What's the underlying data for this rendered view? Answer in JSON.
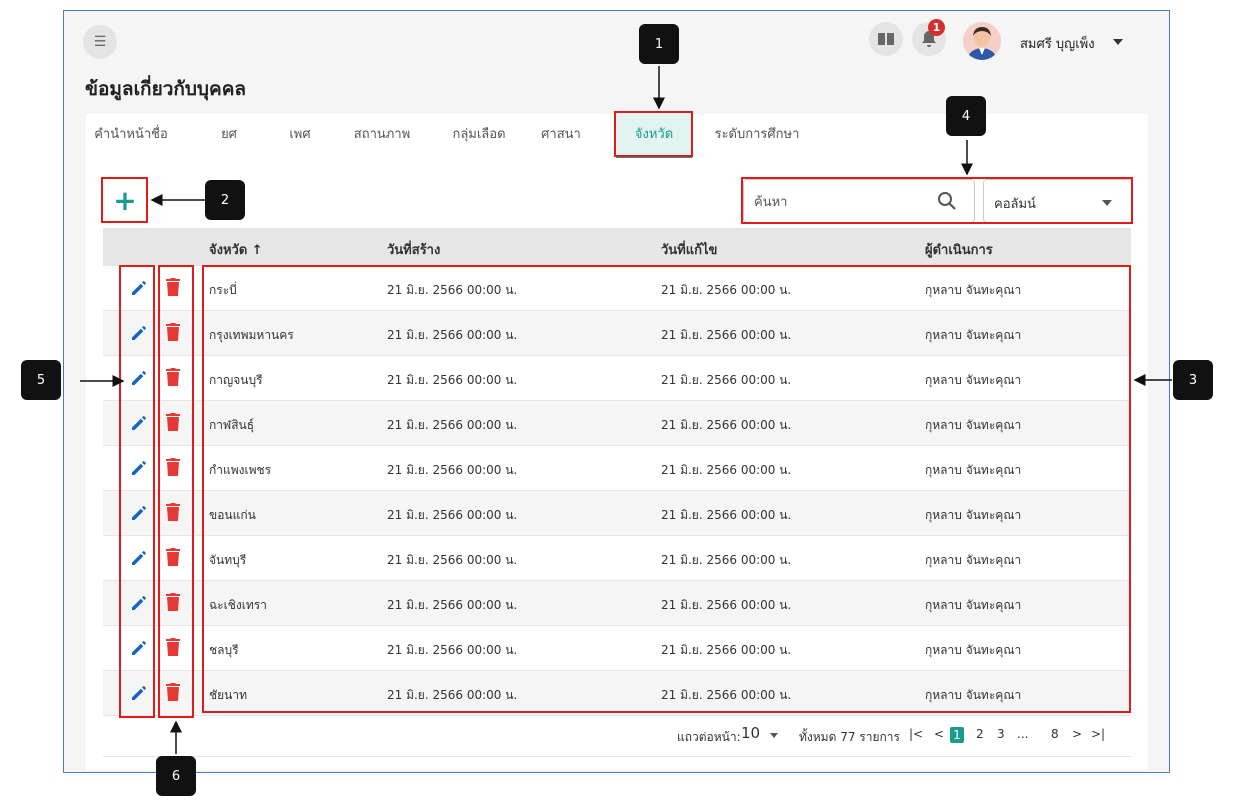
{
  "header": {
    "title": "ข้อมูลเกี่ยวกับบุคคล",
    "notification_count": "1",
    "user_name": "สมศรี บุญเพ็ง"
  },
  "tabs": [
    {
      "label": "คำนำหน้าชื่อ"
    },
    {
      "label": "ยศ"
    },
    {
      "label": "เพศ"
    },
    {
      "label": "สถานภาพ"
    },
    {
      "label": "กลุ่มเลือด"
    },
    {
      "label": "ศาสนา"
    },
    {
      "label": "จังหวัด"
    },
    {
      "label": "ระดับการศึกษา"
    }
  ],
  "toolbar": {
    "add_label": "+",
    "search_placeholder": "ค้นหา",
    "column_select_value": "คอลัมน์"
  },
  "table": {
    "columns": [
      "จังหวัด ↑",
      "วันที่สร้าง",
      "วันที่แก้ไข",
      "ผู้ดำเนินการ"
    ],
    "rows": [
      {
        "province": "กระบี่",
        "created": "21 มิ.ย. 2566 00:00 น.",
        "modified": "21 มิ.ย. 2566 00:00 น.",
        "operator": "กุหลาบ จันทะคุณา"
      },
      {
        "province": "กรุงเทพมหานคร",
        "created": "21 มิ.ย. 2566 00:00 น.",
        "modified": "21 มิ.ย. 2566 00:00 น.",
        "operator": "กุหลาบ จันทะคุณา"
      },
      {
        "province": "กาญจนบุรี",
        "created": "21 มิ.ย. 2566 00:00 น.",
        "modified": "21 มิ.ย. 2566 00:00 น.",
        "operator": "กุหลาบ จันทะคุณา"
      },
      {
        "province": "กาฬสินธุ์",
        "created": "21 มิ.ย. 2566 00:00 น.",
        "modified": "21 มิ.ย. 2566 00:00 น.",
        "operator": "กุหลาบ จันทะคุณา"
      },
      {
        "province": "กำแพงเพชร",
        "created": "21 มิ.ย. 2566 00:00 น.",
        "modified": "21 มิ.ย. 2566 00:00 น.",
        "operator": "กุหลาบ จันทะคุณา"
      },
      {
        "province": "ขอนแก่น",
        "created": "21 มิ.ย. 2566 00:00 น.",
        "modified": "21 มิ.ย. 2566 00:00 น.",
        "operator": "กุหลาบ จันทะคุณา"
      },
      {
        "province": "จันทบุรี",
        "created": "21 มิ.ย. 2566 00:00 น.",
        "modified": "21 มิ.ย. 2566 00:00 น.",
        "operator": "กุหลาบ จันทะคุณา"
      },
      {
        "province": "ฉะเชิงเทรา",
        "created": "21 มิ.ย. 2566 00:00 น.",
        "modified": "21 มิ.ย. 2566 00:00 น.",
        "operator": "กุหลาบ จันทะคุณา"
      },
      {
        "province": "ชลบุรี",
        "created": "21 มิ.ย. 2566 00:00 น.",
        "modified": "21 มิ.ย. 2566 00:00 น.",
        "operator": "กุหลาบ จันทะคุณา"
      },
      {
        "province": "ชัยนาท",
        "created": "21 มิ.ย. 2566 00:00 น.",
        "modified": "21 มิ.ย. 2566 00:00 น.",
        "operator": "กุหลาบ จันทะคุณา"
      }
    ]
  },
  "pagination": {
    "rows_per_page_label": "แถวต่อหน้า:",
    "rows_per_page": "10",
    "total_label": "ทั้งหมด 77 รายการ",
    "first": "|<",
    "prev": "<",
    "pages": [
      "1",
      "2",
      "3",
      "...",
      "8"
    ],
    "next": ">",
    "last": ">|"
  },
  "callouts": [
    "1",
    "2",
    "3",
    "4",
    "5",
    "6"
  ],
  "colors": {
    "accent": "#1a9b8f",
    "delete": "#e53935",
    "edit": "#1565c0",
    "highlight": "#e01b1b"
  }
}
